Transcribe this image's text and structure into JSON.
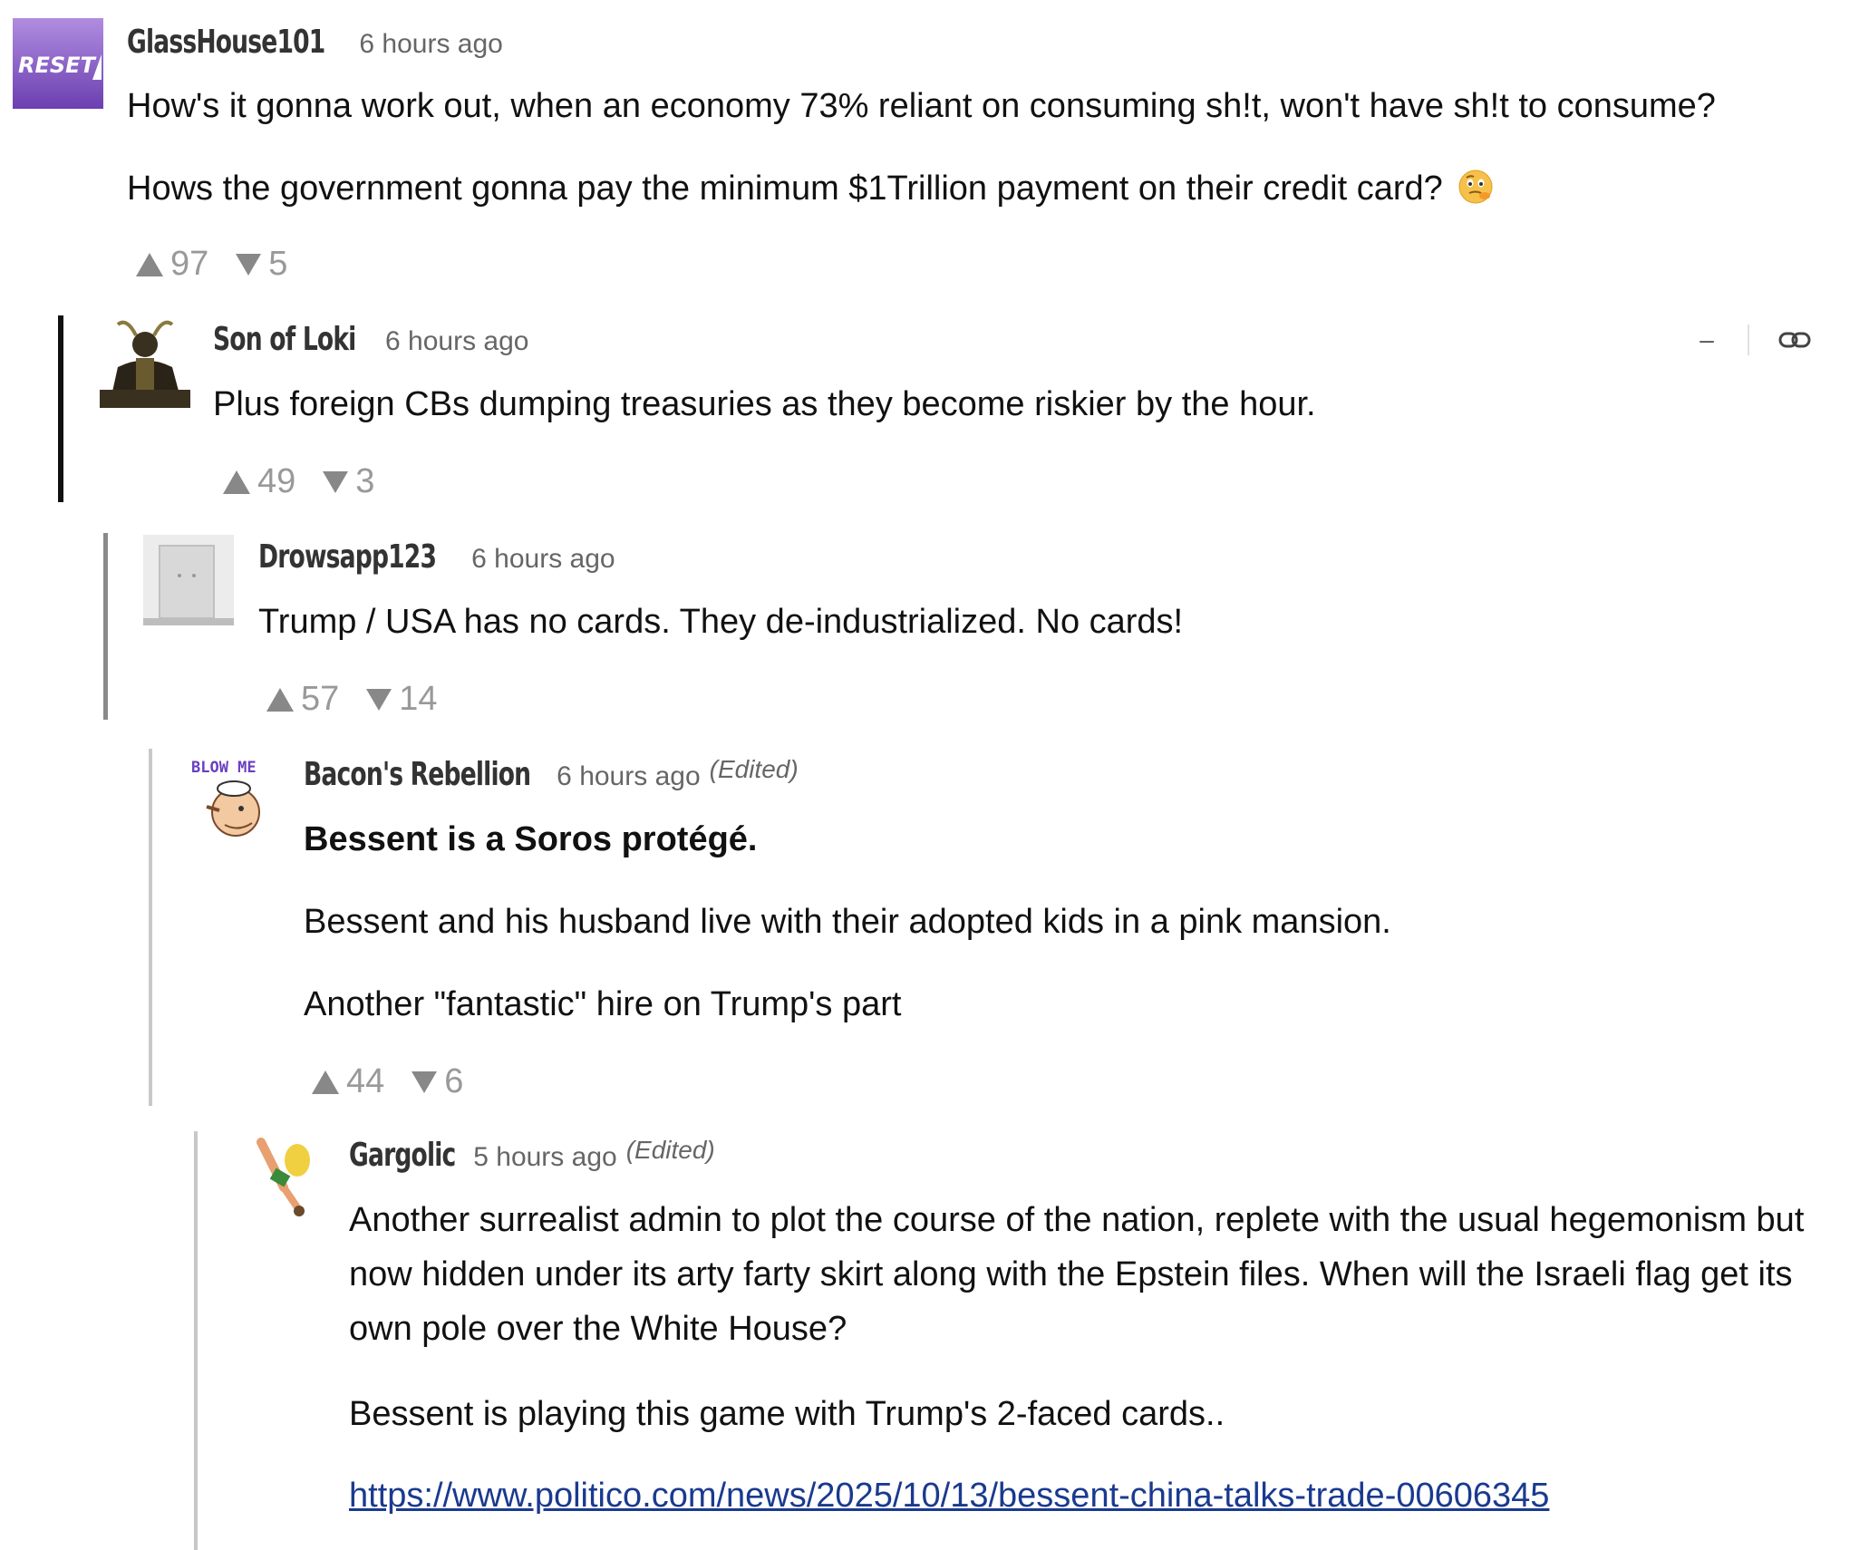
{
  "comments": [
    {
      "username": "GlassHouse101",
      "timestamp": "6 hours ago",
      "avatar_text": "RESET",
      "paragraphs": [
        "How's it gonna work out, when an economy 73% reliant on consuming sh!t, won't have sh!t to consume?",
        "Hows the government gonna pay the minimum $1Trillion payment on their credit card?"
      ],
      "emoji": "thinking-face-icon",
      "upvotes": "97",
      "downvotes": "5"
    },
    {
      "username": "Son of Loki",
      "timestamp": "6 hours ago",
      "paragraphs": [
        "Plus foreign CBs dumping treasuries as they become riskier by the hour."
      ],
      "upvotes": "49",
      "downvotes": "3",
      "collapse_label": "–"
    },
    {
      "username": "Drowsapp123",
      "timestamp": "6 hours ago",
      "paragraphs": [
        "Trump / USA has no cards.  They de-industrialized.  No cards!"
      ],
      "upvotes": "57",
      "downvotes": "14"
    },
    {
      "username": "Bacon's Rebellion",
      "timestamp": "6 hours ago",
      "edited": "(Edited)",
      "avatar_text": "BLOW ME",
      "paragraphs": [
        "Bessent is a Soros protégé.",
        "Bessent and his husband live with their adopted kids in a pink mansion.",
        "Another \"fantastic\" hire on Trump's part"
      ],
      "upvotes": "44",
      "downvotes": "6"
    },
    {
      "username": "Gargolic",
      "timestamp": "5 hours ago",
      "edited": "(Edited)",
      "paragraphs": [
        "Another surrealist admin to plot the course of the nation, replete with the usual hegemonism but now hidden under its arty farty skirt along with the Epstein files. When will the Israeli flag get its own pole over the White House?",
        "Bessent is playing this game with Trump's 2-faced cards..",
        "https://www.politico.com/news/2025/10/13/bessent-china-talks-trade-00606345"
      ]
    }
  ],
  "colors": {
    "thread_bar_active": "#111111",
    "link": "#1a3a8f",
    "vote": "#888888"
  }
}
